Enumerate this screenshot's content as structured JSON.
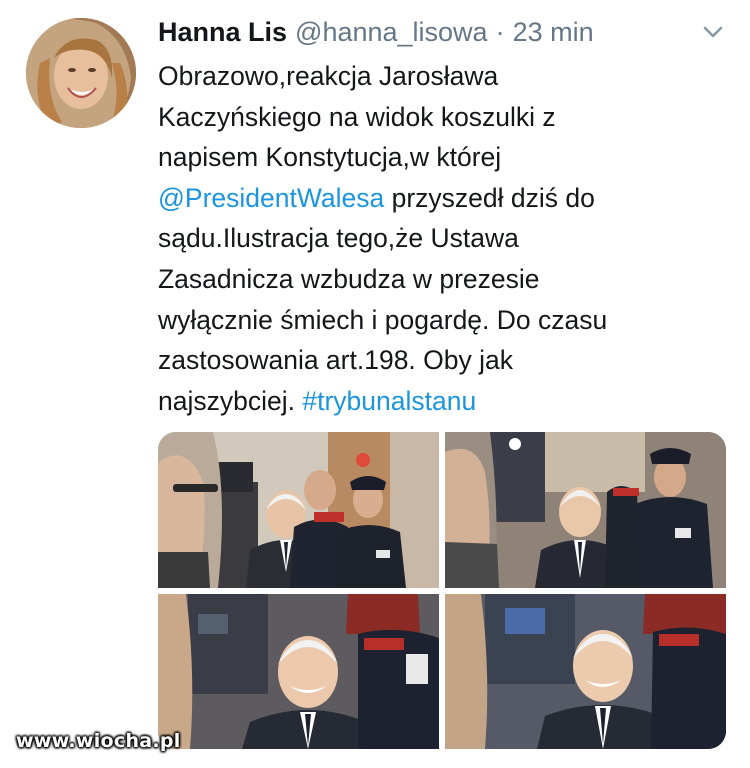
{
  "tweet": {
    "author_name": "Hanna Lis",
    "author_handle": "@hanna_lisowa",
    "separator": "·",
    "time": "23 min",
    "text_parts": [
      "Obrazowo,reakcja Jarosława\nKaczyńskiego na widok koszulki z\nnapisem Konstytucja,w której\n",
      "@PresidentWalesa",
      " przyszedł dziś do\nsądu.Ilustracja tego,że Ustawa\nZasadnicza wzbudza w prezesie\nwyłącznie śmiech i pogardę. Do czasu\nzastosowania art.198. Oby jak\nnajszybciej. ",
      "#trybunalstanu"
    ],
    "media_count": 4
  },
  "icons": {
    "more": "chevron-down-icon"
  },
  "colors": {
    "text": "#14171a",
    "secondary": "#657786",
    "link": "#1b95e0"
  },
  "watermark": {
    "text": "www.wiocha.pl"
  }
}
